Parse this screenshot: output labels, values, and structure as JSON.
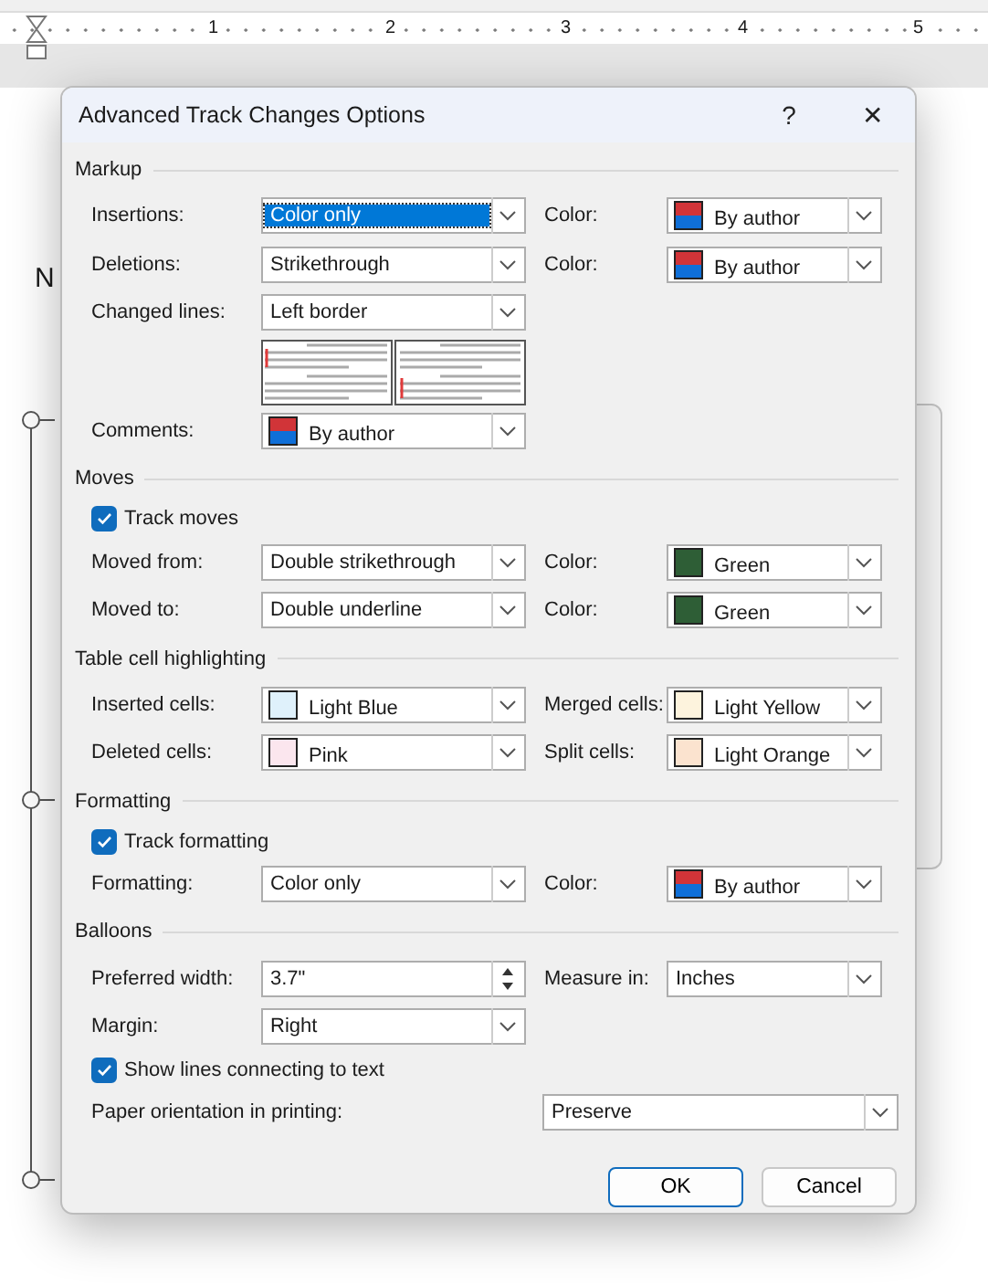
{
  "ruler": {
    "numbers": [
      "1",
      "2",
      "3",
      "4",
      "5"
    ]
  },
  "document": {
    "text": "N"
  },
  "dialog": {
    "title": "Advanced Track Changes Options",
    "help": "?",
    "close": "✕",
    "sections": [
      {
        "title": "Markup",
        "rows": [
          {
            "kind": "pair",
            "left": {
              "label": "Insertions:",
              "control": {
                "kind": "dropdown",
                "value": "Color only",
                "highlighted": true
              }
            },
            "right": {
              "label": "Color:",
              "control": {
                "kind": "swatch",
                "value": "By author",
                "colors": [
                  {
                    "color": "#d13438"
                  },
                  {
                    "color": "#0f6fd8"
                  }
                ]
              }
            }
          },
          {
            "kind": "pair",
            "left": {
              "label": "Deletions:",
              "control": {
                "kind": "dropdown",
                "value": "Strikethrough",
                "highlighted": false
              }
            },
            "right": {
              "label": "Color:",
              "control": {
                "kind": "swatch",
                "value": "By author",
                "colors": [
                  {
                    "color": "#d13438"
                  },
                  {
                    "color": "#0f6fd8"
                  }
                ]
              }
            }
          },
          {
            "kind": "pair",
            "left": {
              "label": "Changed lines:",
              "control": {
                "kind": "dropdown",
                "value": "Left border",
                "highlighted": false
              }
            }
          },
          {
            "kind": "preview"
          },
          {
            "kind": "pair",
            "left": {
              "label": "Comments:",
              "control": {
                "kind": "swatch",
                "value": "By author",
                "colors": [
                  {
                    "color": "#d13438"
                  },
                  {
                    "color": "#0f6fd8"
                  }
                ]
              }
            }
          }
        ]
      },
      {
        "title": "Moves",
        "rows": [
          {
            "kind": "check",
            "label": "Track moves",
            "checked": true
          },
          {
            "kind": "pair",
            "left": {
              "label": "Moved from:",
              "control": {
                "kind": "dropdown",
                "value": "Double strikethrough",
                "highlighted": false
              }
            },
            "right": {
              "label": "Color:",
              "control": {
                "kind": "swatch",
                "value": "Green",
                "colors": [
                  {
                    "color": "#2e5e36"
                  }
                ]
              }
            }
          },
          {
            "kind": "pair",
            "left": {
              "label": "Moved to:",
              "control": {
                "kind": "dropdown",
                "value": "Double underline",
                "highlighted": false
              }
            },
            "right": {
              "label": "Color:",
              "control": {
                "kind": "swatch",
                "value": "Green",
                "colors": [
                  {
                    "color": "#2e5e36"
                  }
                ]
              }
            }
          }
        ]
      },
      {
        "title": "Table cell highlighting",
        "rows": [
          {
            "kind": "pair",
            "left": {
              "label": "Inserted cells:",
              "control": {
                "kind": "swatch",
                "value": "Light Blue",
                "colors": [
                  {
                    "color": "#dff1fb"
                  }
                ]
              }
            },
            "right": {
              "label": "Merged cells:",
              "control": {
                "kind": "swatch",
                "value": "Light Yellow",
                "colors": [
                  {
                    "color": "#fdf3dd"
                  }
                ]
              }
            }
          },
          {
            "kind": "pair",
            "left": {
              "label": "Deleted cells:",
              "control": {
                "kind": "swatch",
                "value": "Pink",
                "colors": [
                  {
                    "color": "#fbe6ee"
                  }
                ]
              }
            },
            "right": {
              "label": "Split cells:",
              "control": {
                "kind": "swatch",
                "value": "Light Orange",
                "colors": [
                  {
                    "color": "#fbe3cf"
                  }
                ]
              }
            }
          }
        ]
      },
      {
        "title": "Formatting",
        "rows": [
          {
            "kind": "check",
            "label": "Track formatting",
            "checked": true
          },
          {
            "kind": "pair",
            "left": {
              "label": "Formatting:",
              "control": {
                "kind": "dropdown",
                "value": "Color only",
                "highlighted": false
              }
            },
            "right": {
              "label": "Color:",
              "control": {
                "kind": "swatch",
                "value": "By author",
                "colors": [
                  {
                    "color": "#d13438"
                  },
                  {
                    "color": "#0f6fd8"
                  }
                ]
              }
            }
          }
        ]
      },
      {
        "title": "Balloons",
        "rows": [
          {
            "kind": "pair",
            "left": {
              "label": "Preferred width:",
              "control": {
                "kind": "spinner",
                "value": "3.7\""
              }
            },
            "right": {
              "label": "Measure in:",
              "control": {
                "kind": "dropdown",
                "value": "Inches",
                "highlighted": false
              }
            }
          },
          {
            "kind": "pair",
            "left": {
              "label": "Margin:",
              "control": {
                "kind": "dropdown",
                "value": "Right",
                "highlighted": false
              }
            }
          },
          {
            "kind": "check",
            "label": "Show lines connecting to text",
            "checked": true
          },
          {
            "kind": "wide",
            "label": "Paper orientation in printing:",
            "control": {
              "kind": "dropdown",
              "value": "Preserve",
              "highlighted": false
            }
          }
        ]
      }
    ],
    "buttons": [
      {
        "label": "OK",
        "default": true
      },
      {
        "label": "Cancel",
        "default": false
      }
    ]
  }
}
